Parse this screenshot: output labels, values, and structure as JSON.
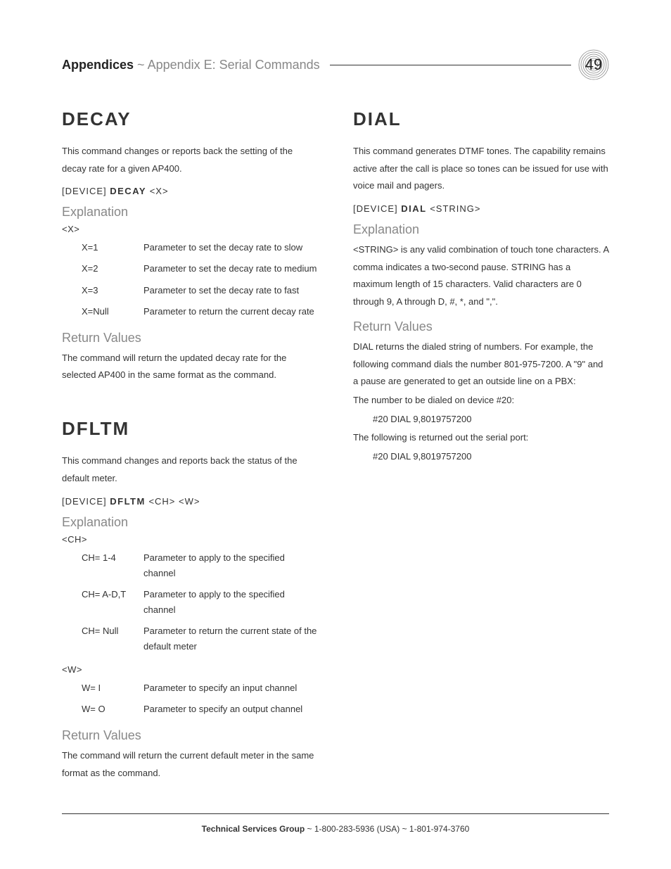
{
  "header": {
    "breadcrumb_strong": "Appendices",
    "breadcrumb_sep": " ~ ",
    "breadcrumb_light": "Appendix E: Serial Commands",
    "page_number": "49"
  },
  "left": {
    "decay": {
      "title": "DECAY",
      "intro": "This command changes or reports back the setting of the decay rate for a given AP400.",
      "syntax_prefix": "[DEVICE] ",
      "syntax_cmd": "DECAY",
      "syntax_args": " <X>",
      "explanation_heading": "Explanation",
      "param_label": "<X>",
      "params": [
        {
          "k": "X=1",
          "v": "Parameter to set the decay rate to slow"
        },
        {
          "k": "X=2",
          "v": "Parameter to set the decay rate to medium"
        },
        {
          "k": "X=3",
          "v": "Parameter to set the decay rate to fast"
        },
        {
          "k": "X=Null",
          "v": "Parameter to return the current decay rate"
        }
      ],
      "return_heading": "Return Values",
      "return_text": "The command will return the updated decay rate for the selected AP400 in the same format as the command."
    },
    "dfltm": {
      "title": "DFLTM",
      "intro": "This command changes and reports back the status of the default meter.",
      "syntax_prefix": "[DEVICE] ",
      "syntax_cmd": "DFLTM",
      "syntax_args": " <CH> <W>",
      "explanation_heading": "Explanation",
      "param1_label": "<CH>",
      "params1": [
        {
          "k": "CH= 1-4",
          "v": "Parameter to apply to the specified channel"
        },
        {
          "k": "CH= A-D,T",
          "v": "Parameter to apply to the specified channel"
        },
        {
          "k": "CH= Null",
          "v": "Parameter to return the current state of the default meter"
        }
      ],
      "param2_label": "<W>",
      "params2": [
        {
          "k": "W= I",
          "v": "Parameter to specify an input channel"
        },
        {
          "k": "W= O",
          "v": "Parameter to specify an output channel"
        }
      ],
      "return_heading": "Return Values",
      "return_text": "The command will return the current default meter in the same format as the command."
    }
  },
  "right": {
    "dial": {
      "title": "DIAL",
      "intro": "This command generates DTMF tones. The capability remains active after the call is place so tones can be issued for use with voice mail and pagers.",
      "syntax_prefix": "[DEVICE] ",
      "syntax_cmd": "DIAL",
      "syntax_args": " <STRING>",
      "explanation_heading": "Explanation",
      "explanation_text": "<STRING> is any valid combination of touch tone characters. A comma indicates a two-second pause. STRING has a maximum length of 15 characters. Valid characters are 0 through 9, A through D, #, *, and \",\".",
      "return_heading": "Return Values",
      "return_text1": "DIAL returns the dialed string of numbers. For example, the following command dials the number 801-975-7200. A \"9\" and a pause are generated to get an outside line on a PBX:",
      "return_line1": "The number to be dialed on device #20:",
      "return_code1": "#20 DIAL 9,8019757200",
      "return_line2": "The following is returned out the serial port:",
      "return_code2": "#20 DIAL 9,8019757200"
    }
  },
  "footer": {
    "strong": "Technical Services Group",
    "rest": " ~ 1-800-283-5936 (USA) ~ 1-801-974-3760"
  }
}
